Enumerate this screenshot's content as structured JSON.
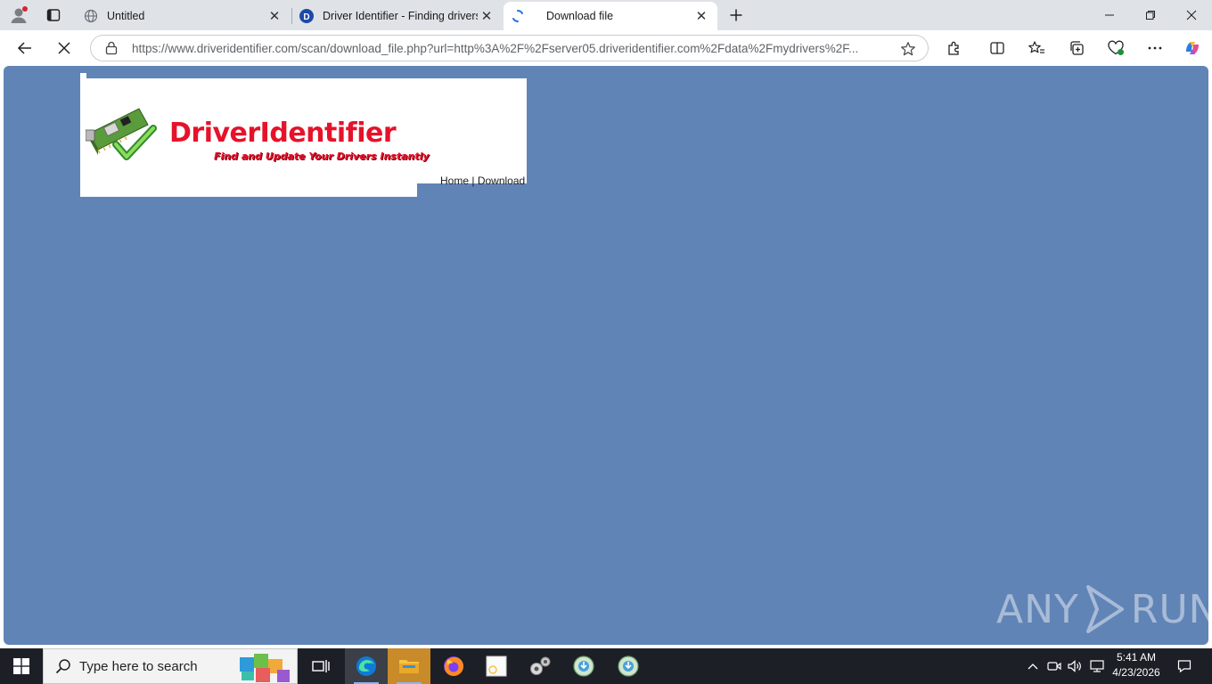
{
  "browser": {
    "tabs": [
      {
        "title": "Untitled",
        "active": false
      },
      {
        "title": "Driver Identifier - Finding drivers f",
        "active": false
      },
      {
        "title": "Download file",
        "active": true
      }
    ],
    "url": "https://www.driveridentifier.com/scan/download_file.php?url=http%3A%2F%2Fserver05.driveridentifier.com%2Fdata%2Fmydrivers%2F..."
  },
  "page": {
    "brand": "DriverIdentifier",
    "tagline": "Find and Update Your Drivers Instantly",
    "nav": {
      "home": "Home",
      "separator": "|",
      "download": "Download"
    },
    "background_color": "#6184b7",
    "brand_color": "#e5132a"
  },
  "watermark": {
    "left": "ANY",
    "right": "RUN"
  },
  "taskbar": {
    "search_placeholder": "Type here to search",
    "time": "5:41 AM",
    "date": "4/23/2026",
    "apps": [
      "task-view-icon",
      "edge-icon",
      "file-explorer-icon",
      "firefox-icon",
      "notepad-icon",
      "gears-icon",
      "installer-icon",
      "installer-icon"
    ]
  }
}
